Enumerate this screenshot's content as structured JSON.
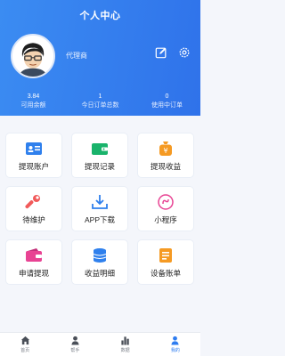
{
  "header": {
    "title": "个人中心",
    "username": "代理商",
    "icons": [
      "edit-icon",
      "settings-icon"
    ],
    "background_color": "#3384f0"
  },
  "stats": [
    {
      "value": "3.84",
      "label": "可用余额"
    },
    {
      "value": "1",
      "label": "今日订单总数"
    },
    {
      "value": "0",
      "label": "使用中订单"
    }
  ],
  "menu": [
    {
      "label": "提现账户",
      "icon": "id-card-icon",
      "color": "#2f80ed"
    },
    {
      "label": "提现记录",
      "icon": "wallet-icon",
      "color": "#19b36b"
    },
    {
      "label": "提现收益",
      "icon": "money-bag-icon",
      "color": "#f59a23"
    },
    {
      "label": "待维护",
      "icon": "wrench-icon",
      "color": "#f15a5a"
    },
    {
      "label": "APP下载",
      "icon": "download-icon",
      "color": "#2f80ed"
    },
    {
      "label": "小程序",
      "icon": "mini-program-icon",
      "color": "#e84393"
    },
    {
      "label": "申请提现",
      "icon": "purse-icon",
      "color": "#e84393"
    },
    {
      "label": "收益明细",
      "icon": "coins-stack-icon",
      "color": "#2f80ed"
    },
    {
      "label": "设备账单",
      "icon": "invoice-icon",
      "color": "#f59a23"
    }
  ],
  "tabs": [
    {
      "label": "首页",
      "icon": "home-icon",
      "active": false
    },
    {
      "label": "帮手",
      "icon": "person-icon",
      "active": false
    },
    {
      "label": "数据",
      "icon": "bar-chart-icon",
      "active": false
    },
    {
      "label": "我的",
      "icon": "user-icon",
      "active": true
    }
  ],
  "accent_color": "#2d7cf0"
}
